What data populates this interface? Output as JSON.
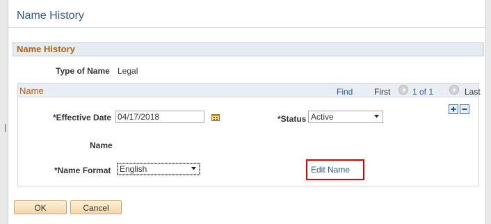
{
  "dialog": {
    "title": "Name History"
  },
  "section": {
    "title": "Name History",
    "type_of_name_label": "Type of Name",
    "type_of_name_value": "Legal"
  },
  "grid": {
    "title": "Name",
    "find_label": "Find",
    "first_label": "First",
    "count_label": "1 of 1",
    "last_label": "Last"
  },
  "fields": {
    "effective_date_label": "*Effective Date",
    "effective_date_value": "04/17/2018",
    "status_label": "*Status",
    "status_value": "Active",
    "name_label": "Name",
    "name_format_label": "*Name Format",
    "name_format_value": "English",
    "edit_name_label": "Edit Name"
  },
  "buttons": {
    "ok": "OK",
    "cancel": "Cancel"
  },
  "colors": {
    "section_title": "#b45f0e",
    "link": "#245c9c",
    "highlight_box": "#e00000",
    "button_bg": "#f4d8a8"
  },
  "icons": {
    "add_row": "plus-icon",
    "delete_row": "minus-icon",
    "previous": "chevron-left-icon",
    "next": "chevron-right-icon",
    "calendar": "calendar-icon"
  }
}
